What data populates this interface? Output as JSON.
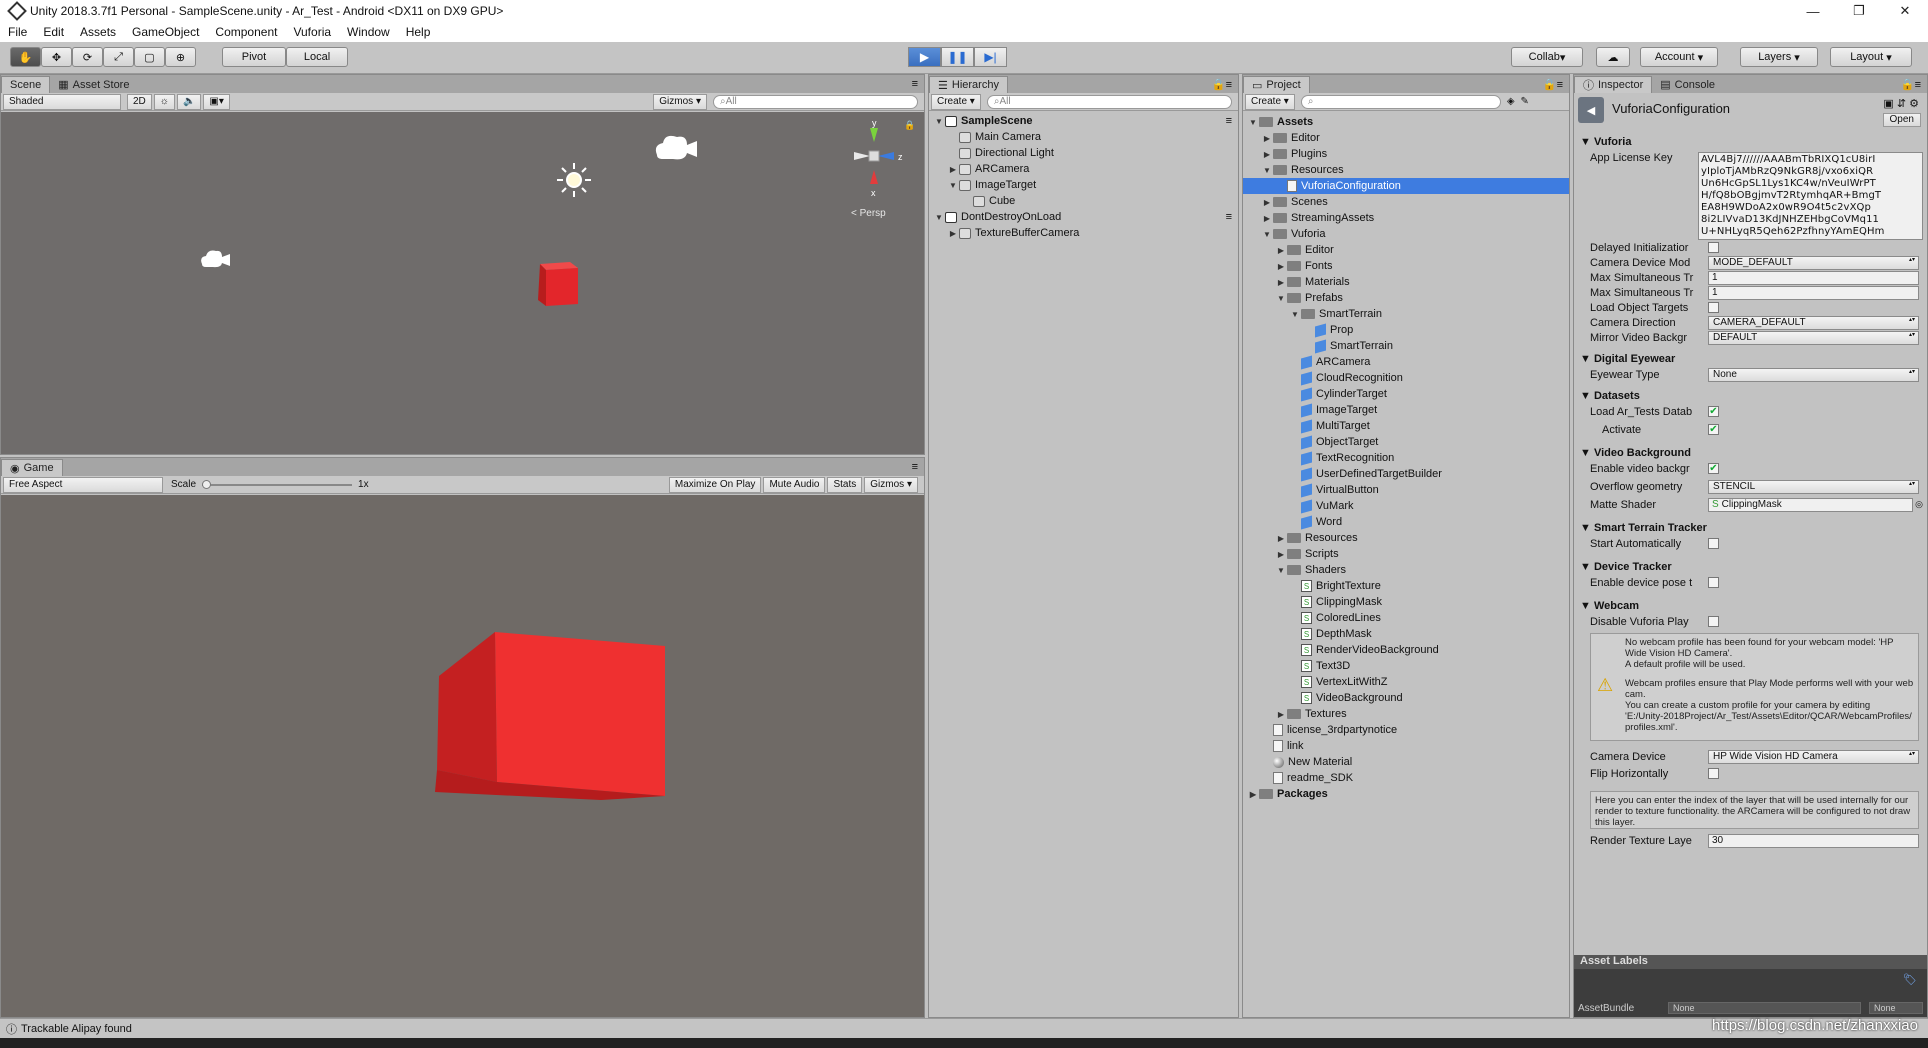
{
  "window": {
    "title": "Unity 2018.3.7f1 Personal - SampleScene.unity - Ar_Test - Android <DX11 on DX9 GPU>"
  },
  "menu": [
    "File",
    "Edit",
    "Assets",
    "GameObject",
    "Component",
    "Vuforia",
    "Window",
    "Help"
  ],
  "toolbar": {
    "pivot": "Pivot",
    "local": "Local",
    "collab": "Collab",
    "account": "Account",
    "layers": "Layers",
    "layout": "Layout"
  },
  "scene": {
    "tab_scene": "Scene",
    "tab_asset_store": "Asset Store",
    "shaded": "Shaded",
    "mode_2d": "2D",
    "gizmos": "Gizmos",
    "search_placeholder": "All",
    "persp": "Persp"
  },
  "game": {
    "tab": "Game",
    "aspect": "Free Aspect",
    "scale_label": "Scale",
    "scale_value": "1x",
    "maximize": "Maximize On Play",
    "mute": "Mute Audio",
    "stats": "Stats",
    "gizmos": "Gizmos"
  },
  "hierarchy": {
    "tab": "Hierarchy",
    "create": "Create",
    "search_placeholder": "All",
    "rows": [
      {
        "label": "SampleScene",
        "depth": 0,
        "arrow": "▼",
        "icon": "scene",
        "bold": true
      },
      {
        "label": "Main Camera",
        "depth": 1,
        "arrow": "",
        "icon": "go"
      },
      {
        "label": "Directional Light",
        "depth": 1,
        "arrow": "",
        "icon": "go"
      },
      {
        "label": "ARCamera",
        "depth": 1,
        "arrow": "▶",
        "icon": "go"
      },
      {
        "label": "ImageTarget",
        "depth": 1,
        "arrow": "▼",
        "icon": "go"
      },
      {
        "label": "Cube",
        "depth": 2,
        "arrow": "",
        "icon": "go"
      },
      {
        "label": "DontDestroyOnLoad",
        "depth": 0,
        "arrow": "▼",
        "icon": "scene"
      },
      {
        "label": "TextureBufferCamera",
        "depth": 1,
        "arrow": "▶",
        "icon": "go"
      }
    ]
  },
  "project": {
    "tab": "Project",
    "create": "Create",
    "rows": [
      {
        "label": "Assets",
        "depth": 0,
        "arrow": "▼",
        "icon": "folder",
        "bold": true
      },
      {
        "label": "Editor",
        "depth": 1,
        "arrow": "▶",
        "icon": "folder"
      },
      {
        "label": "Plugins",
        "depth": 1,
        "arrow": "▶",
        "icon": "folder"
      },
      {
        "label": "Resources",
        "depth": 1,
        "arrow": "▼",
        "icon": "folder"
      },
      {
        "label": "VuforiaConfiguration",
        "depth": 2,
        "arrow": "",
        "icon": "file",
        "selected": true
      },
      {
        "label": "Scenes",
        "depth": 1,
        "arrow": "▶",
        "icon": "folder"
      },
      {
        "label": "StreamingAssets",
        "depth": 1,
        "arrow": "▶",
        "icon": "folder"
      },
      {
        "label": "Vuforia",
        "depth": 1,
        "arrow": "▼",
        "icon": "folder"
      },
      {
        "label": "Editor",
        "depth": 2,
        "arrow": "▶",
        "icon": "folder"
      },
      {
        "label": "Fonts",
        "depth": 2,
        "arrow": "▶",
        "icon": "folder"
      },
      {
        "label": "Materials",
        "depth": 2,
        "arrow": "▶",
        "icon": "folder"
      },
      {
        "label": "Prefabs",
        "depth": 2,
        "arrow": "▼",
        "icon": "folder"
      },
      {
        "label": "SmartTerrain",
        "depth": 3,
        "arrow": "▼",
        "icon": "folder"
      },
      {
        "label": "Prop",
        "depth": 4,
        "arrow": "",
        "icon": "prefab"
      },
      {
        "label": "SmartTerrain",
        "depth": 4,
        "arrow": "",
        "icon": "prefab"
      },
      {
        "label": "ARCamera",
        "depth": 3,
        "arrow": "",
        "icon": "prefab"
      },
      {
        "label": "CloudRecognition",
        "depth": 3,
        "arrow": "",
        "icon": "prefab"
      },
      {
        "label": "CylinderTarget",
        "depth": 3,
        "arrow": "",
        "icon": "prefab"
      },
      {
        "label": "ImageTarget",
        "depth": 3,
        "arrow": "",
        "icon": "prefab"
      },
      {
        "label": "MultiTarget",
        "depth": 3,
        "arrow": "",
        "icon": "prefab"
      },
      {
        "label": "ObjectTarget",
        "depth": 3,
        "arrow": "",
        "icon": "prefab"
      },
      {
        "label": "TextRecognition",
        "depth": 3,
        "arrow": "",
        "icon": "prefab"
      },
      {
        "label": "UserDefinedTargetBuilder",
        "depth": 3,
        "arrow": "",
        "icon": "prefab"
      },
      {
        "label": "VirtualButton",
        "depth": 3,
        "arrow": "",
        "icon": "prefab"
      },
      {
        "label": "VuMark",
        "depth": 3,
        "arrow": "",
        "icon": "prefab"
      },
      {
        "label": "Word",
        "depth": 3,
        "arrow": "",
        "icon": "prefab"
      },
      {
        "label": "Resources",
        "depth": 2,
        "arrow": "▶",
        "icon": "folder"
      },
      {
        "label": "Scripts",
        "depth": 2,
        "arrow": "▶",
        "icon": "folder"
      },
      {
        "label": "Shaders",
        "depth": 2,
        "arrow": "▼",
        "icon": "folder"
      },
      {
        "label": "BrightTexture",
        "depth": 3,
        "arrow": "",
        "icon": "script"
      },
      {
        "label": "ClippingMask",
        "depth": 3,
        "arrow": "",
        "icon": "script"
      },
      {
        "label": "ColoredLines",
        "depth": 3,
        "arrow": "",
        "icon": "script"
      },
      {
        "label": "DepthMask",
        "depth": 3,
        "arrow": "",
        "icon": "script"
      },
      {
        "label": "RenderVideoBackground",
        "depth": 3,
        "arrow": "",
        "icon": "script"
      },
      {
        "label": "Text3D",
        "depth": 3,
        "arrow": "",
        "icon": "script"
      },
      {
        "label": "VertexLitWithZ",
        "depth": 3,
        "arrow": "",
        "icon": "script"
      },
      {
        "label": "VideoBackground",
        "depth": 3,
        "arrow": "",
        "icon": "script"
      },
      {
        "label": "Textures",
        "depth": 2,
        "arrow": "▶",
        "icon": "folder"
      },
      {
        "label": "license_3rdpartynotice",
        "depth": 1,
        "arrow": "",
        "icon": "file"
      },
      {
        "label": "link",
        "depth": 1,
        "arrow": "",
        "icon": "file"
      },
      {
        "label": "New Material",
        "depth": 1,
        "arrow": "",
        "icon": "mat"
      },
      {
        "label": "readme_SDK",
        "depth": 1,
        "arrow": "",
        "icon": "file"
      },
      {
        "label": "Packages",
        "depth": 0,
        "arrow": "▶",
        "icon": "folder",
        "bold": true
      }
    ]
  },
  "inspector": {
    "tab_inspector": "Inspector",
    "tab_console": "Console",
    "title": "VuforiaConfiguration",
    "open": "Open",
    "vuforia": {
      "header": "Vuforia",
      "license_label": "App License Key",
      "license_lines": [
        "AVL4Bj7//////AAABmTbRIXQ1cU8irI",
        "yIploTjAMbRzQ9NkGR8j/vxo6xiQR",
        "Un6HcGpSL1Lys1KC4w/nVeuIWrPT",
        "H/fQ8bOBgjmvT2RtymhqAR+BmgT",
        "EA8H9WDoA2x0wR9O4t5c2vXQp",
        "8i2LIVvaD13KdJNHZEHbgCoVMq11",
        "U+NHLyqR5Qeh62PzfhnyYAmEQHm"
      ],
      "delayed": "Delayed Initializatior",
      "camera_mode_label": "Camera Device Mod",
      "camera_mode": "MODE_DEFAULT",
      "max1_label": "Max Simultaneous Tr",
      "max1": "1",
      "max2_label": "Max Simultaneous Tr",
      "max2": "1",
      "load_obj": "Load Object Targets",
      "cam_dir_label": "Camera Direction",
      "cam_dir": "CAMERA_DEFAULT",
      "mirror_label": "Mirror Video Backgr",
      "mirror": "DEFAULT"
    },
    "eyewear": {
      "header": "Digital Eyewear",
      "type_label": "Eyewear Type",
      "type": "None"
    },
    "datasets": {
      "header": "Datasets",
      "load_label": "Load Ar_Tests Datab",
      "activate": "Activate"
    },
    "video": {
      "header": "Video Background",
      "enable": "Enable video backgr",
      "overflow_label": "Overflow geometry",
      "overflow": "STENCIL",
      "matte_label": "Matte Shader",
      "matte": "ClippingMask"
    },
    "smart": {
      "header": "Smart Terrain Tracker",
      "start": "Start Automatically"
    },
    "device": {
      "header": "Device Tracker",
      "enable": "Enable device pose t"
    },
    "webcam": {
      "header": "Webcam",
      "disable": "Disable Vuforia Play",
      "msg1": "No webcam profile has been found for your webcam model: 'HP Wide Vision HD Camera'.\nA default profile will be used.",
      "msg2": "Webcam profiles ensure that Play Mode performs well with your webcam.\nYou can create a custom profile for your camera by editing\n'E:/Unity-2018Project/Ar_Test/Assets\\Editor/QCAR/WebcamProfiles/profiles.xml'.",
      "cam_label": "Camera Device",
      "cam": "HP Wide Vision HD Camera",
      "flip": "Flip Horizontally"
    },
    "render": {
      "help": "Here you can enter the index of the layer that will be used internally for our render to texture functionality. the ARCamera will be configured to not draw this layer.",
      "label": "Render Texture Laye",
      "value": "30"
    },
    "asset_labels": "Asset Labels",
    "assetbundle_label": "AssetBundle",
    "assetbundle": "None",
    "variant": "None"
  },
  "status": {
    "message": "Trackable Alipay found"
  },
  "watermark": "https://blog.csdn.net/zhanxxiao",
  "colors": {
    "accent": "#3e7ce0",
    "cube": "#e3262b",
    "scene_bg": "#6f6c6b"
  }
}
